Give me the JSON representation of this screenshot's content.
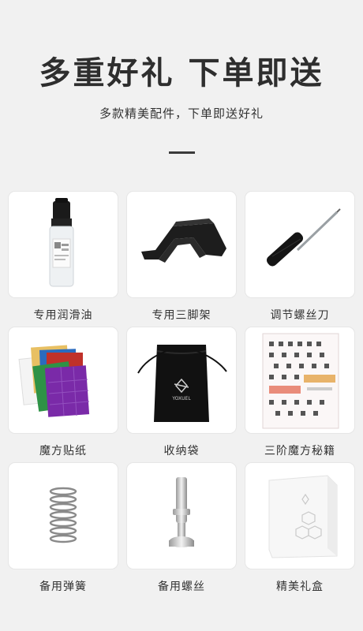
{
  "header": {
    "title": "多重好礼 下单即送",
    "subtitle": "多款精美配件，下单即送好礼"
  },
  "items": [
    {
      "label": "专用润滑油",
      "icon": "lubricant-bottle-icon"
    },
    {
      "label": "专用三脚架",
      "icon": "cube-stand-icon"
    },
    {
      "label": "调节螺丝刀",
      "icon": "screwdriver-icon"
    },
    {
      "label": "魔方贴纸",
      "icon": "sticker-sheets-icon"
    },
    {
      "label": "收纳袋",
      "icon": "storage-bag-icon"
    },
    {
      "label": "三阶魔方秘籍",
      "icon": "guide-sheet-icon"
    },
    {
      "label": "备用弹簧",
      "icon": "spring-icon"
    },
    {
      "label": "备用螺丝",
      "icon": "screw-icon"
    },
    {
      "label": "精美礼盒",
      "icon": "gift-box-icon"
    }
  ],
  "brand_mark": "YOXUEL"
}
